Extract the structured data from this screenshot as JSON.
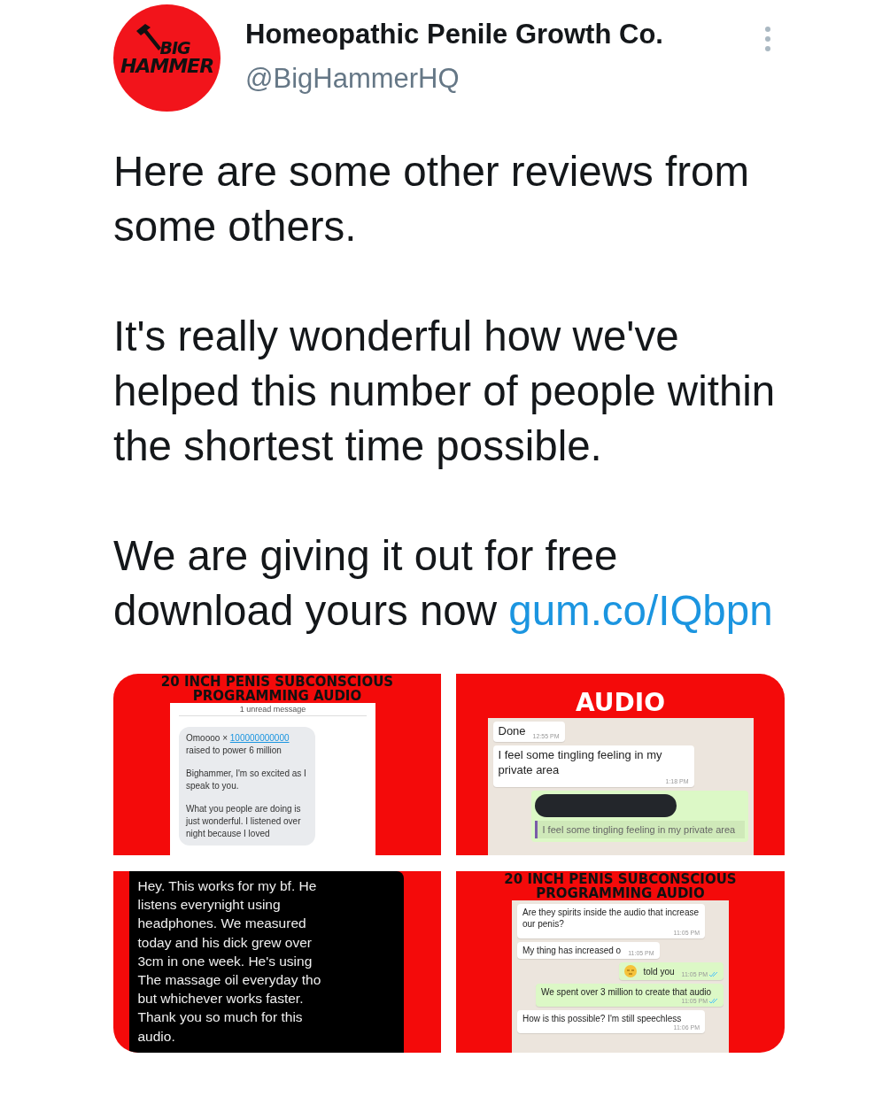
{
  "account": {
    "avatar_text": [
      "BIG",
      "HAMMER"
    ],
    "name": "Homeopathic Penile Growth Co.",
    "handle": "@BigHammerHQ"
  },
  "tweet": {
    "paragraphs": [
      {
        "text": "Here are some other reviews from some others."
      },
      {
        "text": "It's really wonderful how we've helped this number of people within the shortest time possible."
      },
      {
        "text": "We are giving it out for free download yours now",
        "link": "gum.co/IQbpn"
      }
    ]
  },
  "images": [
    {
      "kind": "sms",
      "title": {
        "kind": "dark",
        "lines": [
          "20 INCH PENIS SUBCONSCIOUS",
          "PROGRAMMING AUDIO"
        ]
      },
      "divider": "1 unread message",
      "paragraphs": [
        {
          "text": "Omoooo ×",
          "link": "100000000000",
          "rest": "raised to power 6 million"
        },
        {
          "text": "Bighammer, I'm so excited as I speak to you."
        },
        {
          "text": "What you people are doing is just wonderful. I listened over night because I loved"
        }
      ]
    },
    {
      "kind": "chat",
      "title": {
        "kind": "light",
        "lines": [
          "AUDIO"
        ]
      },
      "messages": [
        {
          "kind": "in",
          "text": "Done",
          "time": "12:55 PM"
        },
        {
          "kind": "in",
          "text": "I feel some tingling feeling in my private area",
          "time": "1:18 PM"
        },
        {
          "kind": "reply",
          "quote": "I feel some tingling feeling in my private area"
        }
      ]
    },
    {
      "kind": "note",
      "text": "Hey. This works for my bf. He listens everynight using headphones. We measured today and his dick grew over 3cm in one week. He's using The massage oil everyday tho but whichever works faster. Thank you so much for this audio."
    },
    {
      "kind": "chat",
      "title": {
        "kind": "dark",
        "lines": [
          "20 INCH PENIS SUBCONSCIOUS",
          "PROGRAMMING AUDIO"
        ]
      },
      "messages": [
        {
          "kind": "in",
          "text": "Are they spirits inside the audio that increase our penis?",
          "time": "11:05 PM"
        },
        {
          "kind": "in",
          "text": "My thing has increased o",
          "time": "11:05 PM"
        },
        {
          "kind": "out",
          "text": "told you",
          "time": "11:05 PM",
          "emoji": true,
          "read": true
        },
        {
          "kind": "out",
          "text": "We spent over 3 million to create that audio",
          "time": "11:05 PM",
          "emoji": false,
          "read": true
        },
        {
          "kind": "in",
          "text": "How is this possible? I'm still speechless",
          "time": "11:06 PM"
        }
      ]
    }
  ]
}
